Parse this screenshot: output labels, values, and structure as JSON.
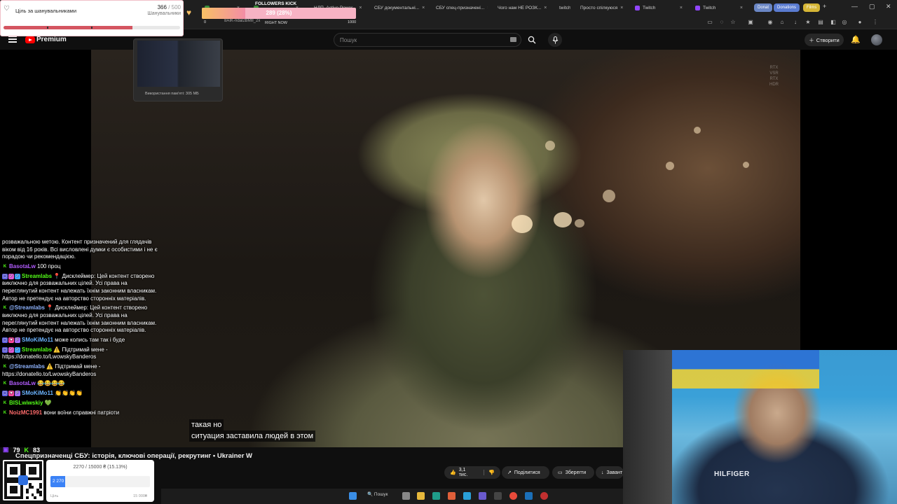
{
  "browser": {
    "tabs": [
      {
        "label": "",
        "color": "#3a8f3a"
      },
      {
        "label": "",
        "color": "#3a8f3a"
      },
      {
        "label": "НДП, Active Power...",
        "color": "#ff3030"
      },
      {
        "label": "СБУ документальні...",
        "color": "#ff3030"
      },
      {
        "label": "СБУ спец-призначені...",
        "color": "#ff3030"
      },
      {
        "label": "Чого нам НЕ РОЗК...",
        "color": "#ff3030"
      },
      {
        "label": "twitch",
        "color": "#9146ff"
      },
      {
        "label": "Просто спілкуюся",
        "color": "#9146ff"
      },
      {
        "label": "Twitch",
        "color": "#9146ff"
      },
      {
        "label": "Twitch",
        "color": "#9146ff"
      }
    ],
    "pills": [
      {
        "label": "Donat",
        "color": "#6a86c4"
      },
      {
        "label": "Donations",
        "color": "#5a7bd0"
      },
      {
        "label": "Films",
        "color": "#d6b636"
      }
    ],
    "url_fragment": "8AIK-ndal2BMIl_2x"
  },
  "youtube": {
    "brand": "Premium",
    "search_placeholder": "Пошук",
    "create_label": "Створити",
    "video_title": "Спецпризначенці СБУ: історія, ключові операції, рекрутинг • Ukrainer W",
    "subtitle_line1": "такая но",
    "subtitle_line2": "ситуация заставила людей в этом",
    "watermark": "RTX\nVSR\nRTX\nHDR",
    "actions": {
      "like": "3,1 тис.",
      "share": "Поділитися",
      "save": "Зберегти",
      "download": "Завант"
    }
  },
  "followers_goal": {
    "title": "Ціль за шанувальниками",
    "current": "366",
    "target": "/ 500",
    "sub": "Шанувальники",
    "progress": 0.732
  },
  "followers_kick": {
    "title": "FOLLOWERS KICK",
    "text": "289 (28%)",
    "progress": 0.28,
    "min": "0",
    "max": "1000",
    "right_now": "RIGHT NOW"
  },
  "tab_preview": {
    "memory": "Використання пам'яті: 305 МБ"
  },
  "chat": [
    {
      "user": "",
      "color": "#ffffff",
      "badges": [],
      "text": "розважальною метою. Контент призначений для глядачів віком від 16 років. Всі висловлені думки є особистими і не є порадою чи рекомендацією."
    },
    {
      "user": "BasotaLw",
      "color": "#b35cff",
      "badges": [
        "kick"
      ],
      "text": "100 проц"
    },
    {
      "user": "Streamlabs",
      "color": "#53fc18",
      "badges": [
        "mod",
        "vip",
        "ver"
      ],
      "text": "📍 Дисклеймер: Цей контент створено виключно для розважальних цілей. Усі права на переглянутий контент належать їхнім законним власникам. Автор не претендує на авторство сторонніх матеріалів."
    },
    {
      "user": "@Streamlabs",
      "color": "#8fb4ff",
      "badges": [
        "kick"
      ],
      "text": "📍 Дисклеймер: Цей контент створено виключно для розважальних цілей. Усі права на переглянутий контент належать їхнім законним власникам. Автор не претендує на авторство сторонніх матеріалів."
    },
    {
      "user": "SMoKiMo11",
      "color": "#6cb4ff",
      "badges": [
        "mod",
        "sub",
        "sub2"
      ],
      "text": "може колись там так і буде"
    },
    {
      "user": "Streamlabs",
      "color": "#53fc18",
      "badges": [
        "mod",
        "vip",
        "ver"
      ],
      "text": "⚠️ Підтримай мене - https://donatello.to/LwowskyBanderos"
    },
    {
      "user": "@Streamlabs",
      "color": "#8fb4ff",
      "badges": [
        "kick"
      ],
      "text": "⚠️ Підтримай мене - https://donatello.to/LwowskyBanderos"
    },
    {
      "user": "BasotaLw",
      "color": "#b35cff",
      "badges": [
        "kick"
      ],
      "text": "😂😂😂😂"
    },
    {
      "user": "SMoKiMo11",
      "color": "#6cb4ff",
      "badges": [
        "mod",
        "sub",
        "sub2"
      ],
      "text": "👏👏👏👏"
    },
    {
      "user": "BISLwiwskiy",
      "color": "#53fc18",
      "badges": [
        "kick"
      ],
      "text": "💚"
    },
    {
      "user": "NoizMC1991",
      "color": "#ff6b6b",
      "badges": [
        "kick"
      ],
      "text": "вони воїни справжні патріоти"
    }
  ],
  "viewer_stats": {
    "twitch": "79",
    "kick": "83"
  },
  "donation_goal": {
    "text": "2270 / 15000 ₴ (15.13%)",
    "value": "2 270",
    "progress": 0.1513,
    "min": "Ціль",
    "max": "15 000₴"
  },
  "webcam": {
    "shirt_text": "HILFIGER"
  },
  "taskbar": {
    "search_label": "Пошук"
  }
}
